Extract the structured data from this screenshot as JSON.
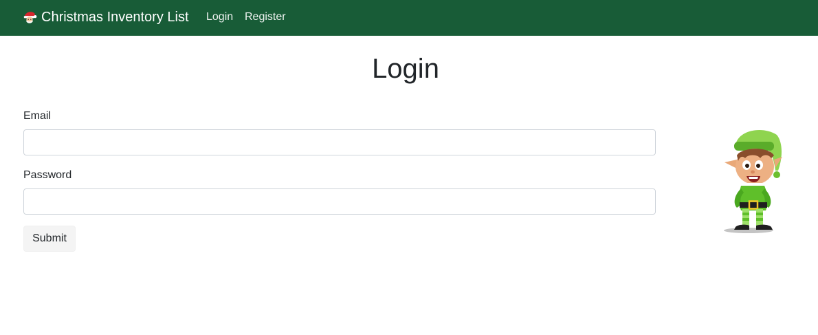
{
  "navbar": {
    "brand_icon": "santa-face-icon",
    "brand_text": "Christmas Inventory List",
    "links": [
      {
        "label": "Login"
      },
      {
        "label": "Register"
      }
    ],
    "background_color": "#185c37"
  },
  "main": {
    "title": "Login",
    "form": {
      "email_label": "Email",
      "email_value": "",
      "password_label": "Password",
      "password_value": "",
      "submit_label": "Submit"
    },
    "illustration": "elf-illustration"
  }
}
